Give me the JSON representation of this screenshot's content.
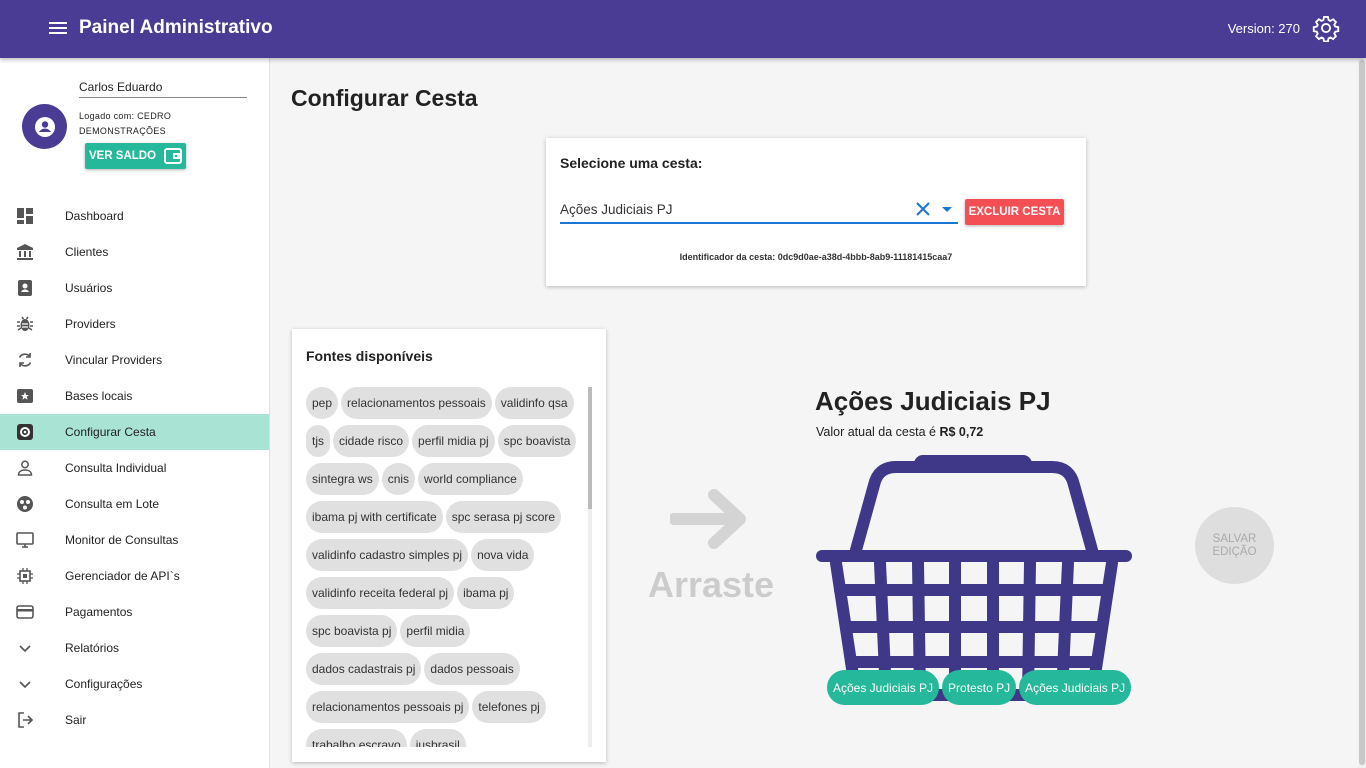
{
  "header": {
    "title": "Painel Administrativo",
    "version": "Version: 270",
    "menu_icon": "menu-icon",
    "settings_icon": "gear-icon",
    "color": "#4a3b94"
  },
  "user": {
    "name": "Carlos Eduardo",
    "logged_line1": "Logado com: CEDRO",
    "logged_line2": "DEMONSTRAÇÕES",
    "saldo_label": "VER SALDO"
  },
  "sidebar": {
    "items": [
      {
        "label": "Dashboard",
        "icon": "dashboard-icon"
      },
      {
        "label": "Clientes",
        "icon": "bank-icon"
      },
      {
        "label": "Usuários",
        "icon": "contact-icon"
      },
      {
        "label": "Providers",
        "icon": "bug-icon"
      },
      {
        "label": "Vincular Providers",
        "icon": "sync-icon"
      },
      {
        "label": "Bases locais",
        "icon": "star-box-icon"
      },
      {
        "label": "Configurar Cesta",
        "icon": "cog-box-icon",
        "active": true
      },
      {
        "label": "Consulta Individual",
        "icon": "person-icon"
      },
      {
        "label": "Consulta em Lote",
        "icon": "group-icon"
      },
      {
        "label": "Monitor de Consultas",
        "icon": "monitor-icon"
      },
      {
        "label": "Gerenciador de API`s",
        "icon": "chip-icon"
      },
      {
        "label": "Pagamentos",
        "icon": "credit-card-icon"
      },
      {
        "label": "Relatórios",
        "icon": "chevron-down-icon"
      },
      {
        "label": "Configurações",
        "icon": "chevron-down-icon"
      },
      {
        "label": "Sair",
        "icon": "logout-icon"
      }
    ],
    "active_color": "#a8e3d4"
  },
  "main": {
    "title": "Configurar Cesta",
    "select_card": {
      "label": "Selecione uma cesta:",
      "value": "Ações Judiciais PJ",
      "excluir_label": "EXCLUIR CESTA",
      "identificador": "Identificador da cesta: 0dc9d0ae-a38d-4bbb-8ab9-11181415caa7"
    },
    "fontes": {
      "title": "Fontes disponíveis",
      "chips": [
        "pep",
        "relacionamentos pessoais",
        "validinfo qsa",
        "tjs",
        "cidade risco",
        "perfil midia pj",
        "spc boavista",
        "sintegra ws",
        "cnis",
        "world compliance",
        "ibama pj with certificate",
        "spc serasa pj score",
        "validinfo cadastro simples pj",
        "nova vida",
        "validinfo receita federal pj",
        "ibama pj",
        "spc boavista pj",
        "perfil midia",
        "dados cadastrais pj",
        "dados pessoais",
        "relacionamentos pessoais pj",
        "telefones pj",
        "trabalho escravo",
        "jusbrasil"
      ]
    },
    "arraste": "Arraste",
    "cesta": {
      "title": "Ações Judiciais PJ",
      "valor_prefix": "Valor atual da cesta é ",
      "valor": "R$ 0,72",
      "items": [
        "Ações Judiciais PJ",
        "Protesto PJ",
        "Ações Judiciais PJ"
      ],
      "basket_color": "#3f3788",
      "chip_color": "#26b89a"
    },
    "salvar_label_1": "SALVAR",
    "salvar_label_2": "EDIÇÃO"
  }
}
